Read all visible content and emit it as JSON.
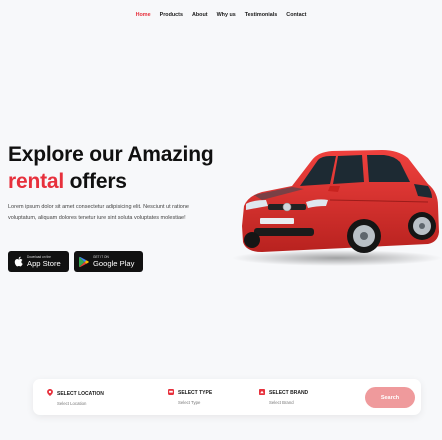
{
  "nav": {
    "items": [
      {
        "label": "Home",
        "active": true
      },
      {
        "label": "Products"
      },
      {
        "label": "About"
      },
      {
        "label": "Why us"
      },
      {
        "label": "Testimonials"
      },
      {
        "label": "Contact"
      }
    ]
  },
  "hero": {
    "title_line1": "Explore our Amazing",
    "title_accent": "rental",
    "title_rest": " offers",
    "description": "Lorem ipsum dolor sit amet consectetur adipisicing elit. Nesciunt ut ratione voluptatum, aliquam dolores tenetur iure sint soluta voluptates molestiae!"
  },
  "store_buttons": {
    "apple": {
      "small": "Download on the",
      "big": "App Store"
    },
    "google": {
      "small": "GET IT ON",
      "big": "Google Play"
    }
  },
  "search": {
    "location": {
      "label": "SELECT LOCATION",
      "value": "Select Location",
      "icon": "location-pin-icon"
    },
    "type": {
      "label": "SELECT TYPE",
      "value": "Select Type",
      "icon": "car-type-icon"
    },
    "brand": {
      "label": "SELECT BRAND",
      "value": "Select Brand",
      "icon": "brand-icon"
    },
    "button": "Search"
  },
  "colors": {
    "accent": "#e7303c",
    "search_button": "#ef9a9c",
    "car_body": "#e3312f"
  }
}
